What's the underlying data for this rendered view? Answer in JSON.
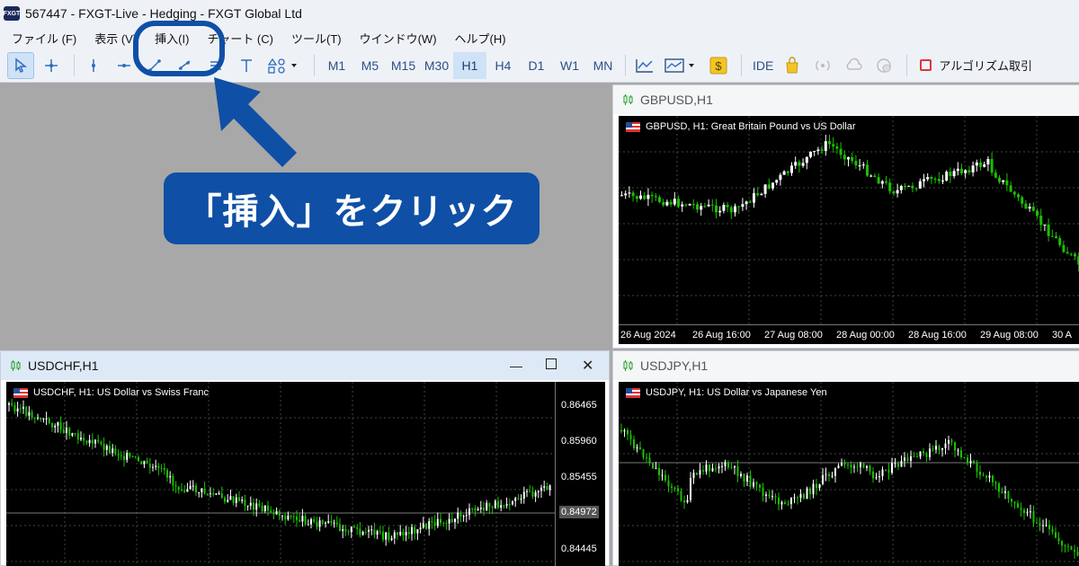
{
  "window": {
    "title": "567447 - FXGT-Live - Hedging - FXGT Global Ltd",
    "logo": "FXGT"
  },
  "menu": [
    "ファイル (F)",
    "表示 (V)",
    "挿入(I)",
    "チャート (C)",
    "ツール(T)",
    "ウインドウ(W)",
    "ヘルプ(H)"
  ],
  "toolbar": {
    "timeframes": [
      "M1",
      "M5",
      "M15",
      "M30",
      "H1",
      "H4",
      "D1",
      "W1",
      "MN"
    ],
    "active_timeframe": "H1",
    "ide_label": "IDE",
    "algo_label": "アルゴリズム取引"
  },
  "annotation": {
    "callout_text": "「挿入」をクリック",
    "color": "#0f4fa6"
  },
  "charts": {
    "gbpusd": {
      "tab": "GBPUSD,H1",
      "caption": "GBPUSD, H1:  Great Britain Pound vs US Dollar",
      "x_ticks": [
        "26 Aug 2024",
        "26 Aug 16:00",
        "27 Aug 08:00",
        "28 Aug 00:00",
        "28 Aug 16:00",
        "29 Aug 08:00",
        "30 A"
      ]
    },
    "usdchf": {
      "tab": "USDCHF,H1",
      "caption": "USDCHF, H1:  US Dollar vs Swiss Franc",
      "y_ticks": [
        "0.86465",
        "0.85960",
        "0.85455",
        "0.84972",
        "0.84445"
      ],
      "current_price": "0.84972"
    },
    "usdjpy": {
      "tab": "USDJPY,H1",
      "caption": "USDJPY, H1:  US Dollar vs Japanese Yen"
    }
  },
  "colors": {
    "bull": "#ffffff",
    "bear": "#19c000",
    "grid": "#3a4a3a"
  }
}
